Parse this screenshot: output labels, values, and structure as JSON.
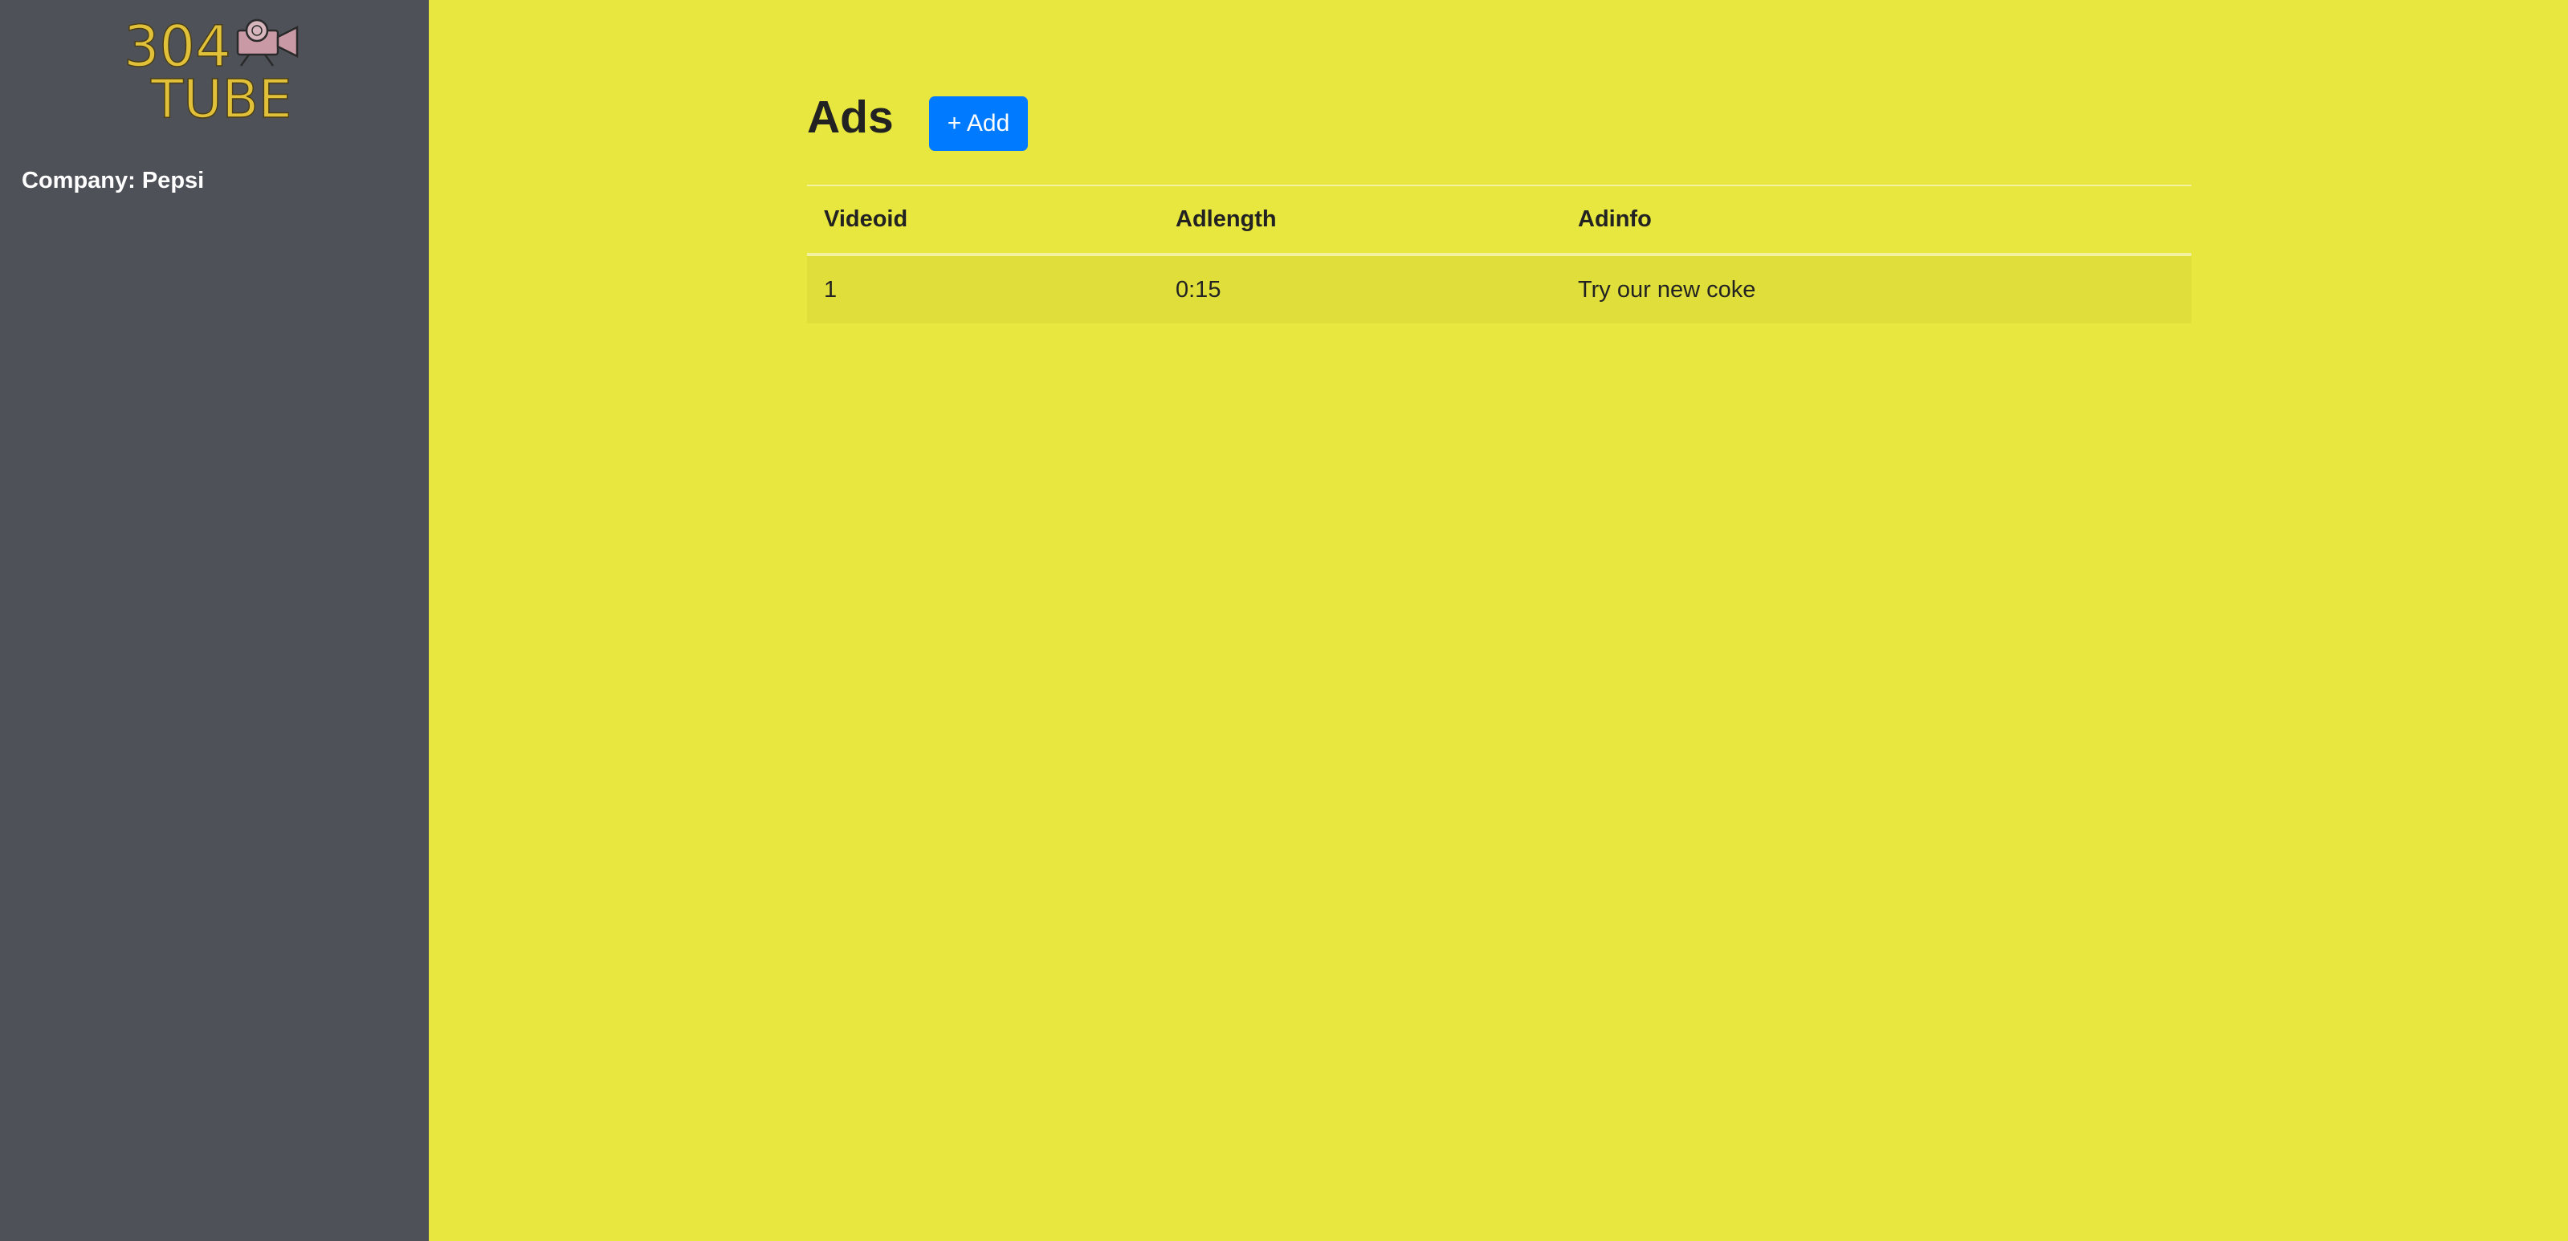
{
  "sidebar": {
    "logo": {
      "text_line1": "304",
      "text_line2": "TUBE",
      "icon": "movie-camera-icon"
    },
    "company_label": "Company: Pepsi"
  },
  "main": {
    "title": "Ads",
    "add_button_label": "+ Add",
    "table": {
      "columns": [
        "Videoid",
        "Adlength",
        "Adinfo"
      ],
      "rows": [
        {
          "videoid": "1",
          "adlength": "0:15",
          "adinfo": "Try our new coke"
        }
      ]
    }
  },
  "colors": {
    "sidebar_bg": "#4f5159",
    "main_bg": "#e8e73f",
    "accent": "#007bff",
    "logo": "#e2c13a"
  }
}
